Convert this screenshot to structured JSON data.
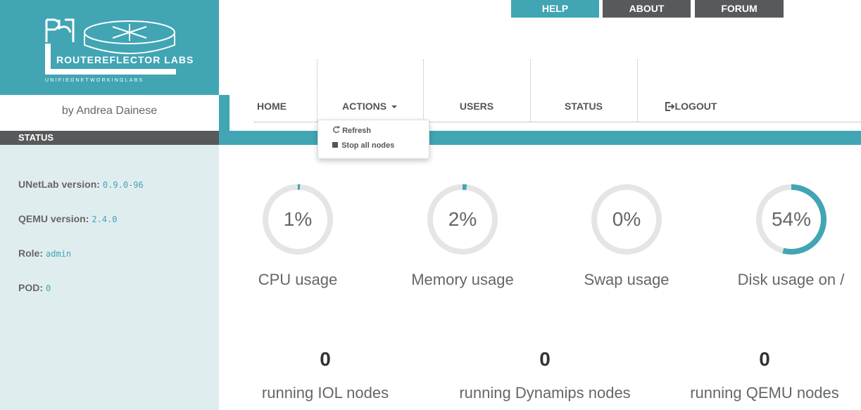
{
  "header": {
    "top_buttons": [
      "HELP",
      "ABOUT",
      "FORUM"
    ],
    "logo_text": "ROUTEREFLECTOR LABS",
    "logo_subtitle": "UNIFIEDNETWORKINGLABS",
    "author": "by Andrea Dainese"
  },
  "nav": {
    "home": "HOME",
    "actions": "ACTIONS",
    "users": "USERS",
    "status": "STATUS",
    "logout": "LOGOUT"
  },
  "actions_menu": {
    "refresh": "Refresh",
    "stop_all": "Stop all nodes"
  },
  "sidebar": {
    "title": "STATUS",
    "rows": [
      {
        "label": "UNetLab version:",
        "value": "0.9.0-96"
      },
      {
        "label": "QEMU version:",
        "value": "2.4.0"
      },
      {
        "label": "Role:",
        "value": "admin"
      },
      {
        "label": "POD:",
        "value": "0"
      }
    ]
  },
  "gauges": [
    {
      "text": "1%",
      "value": 1,
      "label": "CPU usage"
    },
    {
      "text": "2%",
      "value": 2,
      "label": "Memory usage"
    },
    {
      "text": "0%",
      "value": 0,
      "label": "Swap usage"
    },
    {
      "text": "54%",
      "value": 54,
      "label": "Disk usage on /"
    }
  ],
  "counters": [
    {
      "value": "0",
      "label": "running IOL nodes"
    },
    {
      "value": "0",
      "label": "running Dynamips nodes"
    },
    {
      "value": "0",
      "label": "running QEMU nodes"
    }
  ],
  "colors": {
    "accent": "#41a5b4",
    "dark": "#58595b",
    "gauge_track": "#e5e5e5",
    "sidebar_bg": "#e0edef"
  }
}
